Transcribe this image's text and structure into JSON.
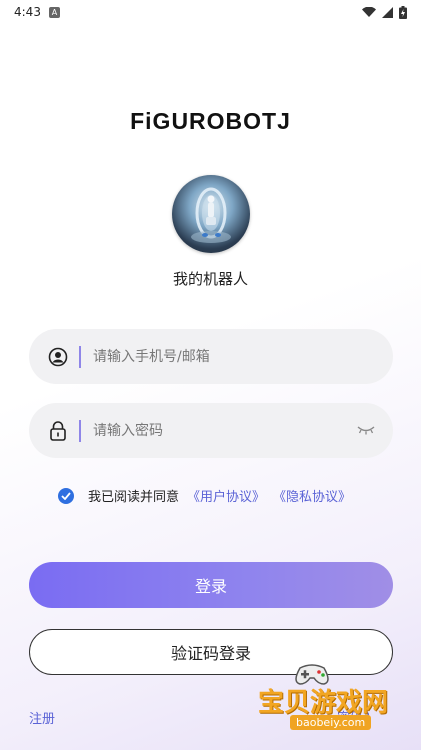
{
  "status_bar": {
    "time": "4:43",
    "badge": "A"
  },
  "logo": {
    "text": "FiGUROBOTJ"
  },
  "profile": {
    "name": "我的机器人"
  },
  "account_field": {
    "placeholder": "请输入手机号/邮箱",
    "icon": "user-icon"
  },
  "password_field": {
    "placeholder": "请输入密码",
    "icon": "lock-icon",
    "toggle_icon": "eye-closed-icon"
  },
  "agreement": {
    "text": "我已阅读并同意",
    "user_agreement": "《用户协议》",
    "privacy_policy": "《隐私协议》",
    "checked": true
  },
  "buttons": {
    "login": "登录",
    "sms_login": "验证码登录"
  },
  "footer": {
    "register": "注册",
    "forgot_password": "密码?"
  },
  "watermark": {
    "title": "宝贝游戏网",
    "url": "baobeiy.com"
  },
  "colors": {
    "accent": "#7a6cf2",
    "link": "#5b63d6",
    "checkbox": "#2f6fe0"
  }
}
